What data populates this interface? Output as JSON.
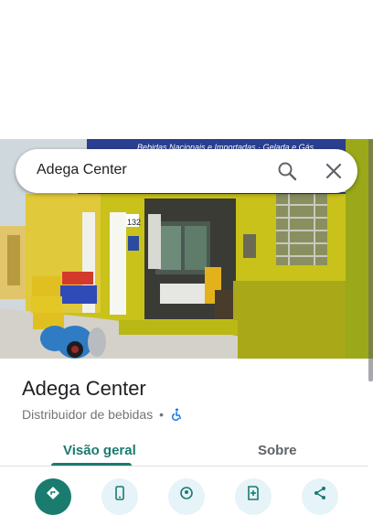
{
  "search": {
    "query": "Adega Center",
    "search_icon": "search-icon",
    "close_icon": "close-icon"
  },
  "photo": {
    "sign_text": "Bebidas Nacionais e Importadas · Gelada e Gás",
    "door_number": "132"
  },
  "place": {
    "name": "Adega Center",
    "category": "Distribuidor de bebidas",
    "separator": "•",
    "accessibility_icon": "wheelchair-icon"
  },
  "tabs": [
    {
      "label": "Visão geral",
      "active": true
    },
    {
      "label": "Sobre",
      "active": false
    }
  ],
  "actions": [
    {
      "icon": "directions-icon",
      "primary": true
    },
    {
      "icon": "phone-icon",
      "primary": false
    },
    {
      "icon": "location-icon",
      "primary": false
    },
    {
      "icon": "save-icon",
      "primary": false
    },
    {
      "icon": "share-icon",
      "primary": false
    }
  ],
  "colors": {
    "accent": "#1a7b6f",
    "action_bg": "#e6f3f8"
  }
}
